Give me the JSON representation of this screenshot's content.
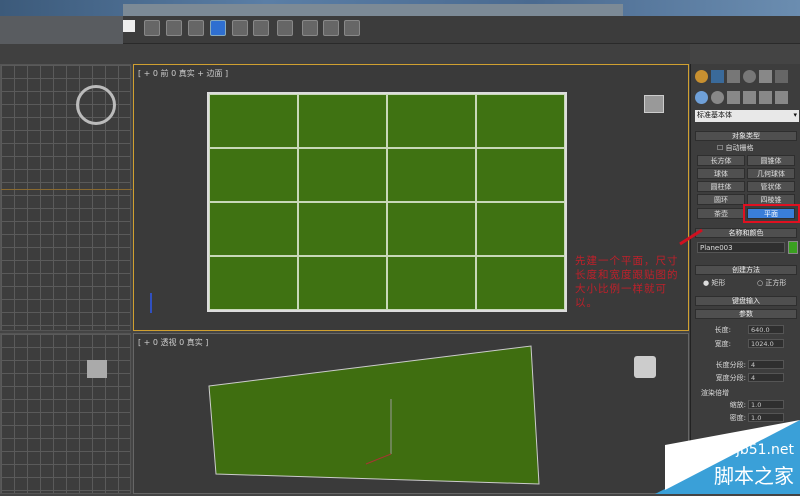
{
  "viewports": {
    "top_label": "[ + 0 前 0 真实 + 边面 ]",
    "persp_label": "[ + 0 透视 0 真实 ]"
  },
  "panel": {
    "dropdown": "标准基本体",
    "object_type": {
      "title": "对象类型",
      "autogrid": "自动栅格",
      "buttons": [
        "长方体",
        "圆锥体",
        "球体",
        "几何球体",
        "圆柱体",
        "管状体",
        "圆环",
        "四棱锥",
        "茶壶",
        "平面"
      ],
      "selected": "平面"
    },
    "name_color": {
      "title": "名称和颜色",
      "name": "Plane003",
      "color": "#3aa020"
    },
    "creation_method": {
      "title": "创建方法",
      "options": [
        "矩形",
        "正方形"
      ],
      "selected": "矩形"
    },
    "keyboard_entry": "键盘输入",
    "params": {
      "title": "参数",
      "length_label": "长度:",
      "length": "640.0",
      "width_label": "宽度:",
      "width": "1024.0",
      "length_segs_label": "长度分段:",
      "length_segs": "4",
      "width_segs_label": "宽度分段:",
      "width_segs": "4",
      "render_mult": "渲染倍增",
      "scale_label": "缩放:",
      "scale": "1.0",
      "density_label": "密度:",
      "density": "1.0"
    }
  },
  "annotation": "先建一个平面，尺寸长度和宽度跟贴图的大小比例一样就可以。",
  "watermark": {
    "site": "jb51.net",
    "name": "脚本之家"
  },
  "colors": {
    "plane": "#3f7212",
    "accent": "#3a7ed8",
    "annotation": "#c0202a",
    "highlight": "#e01020"
  }
}
